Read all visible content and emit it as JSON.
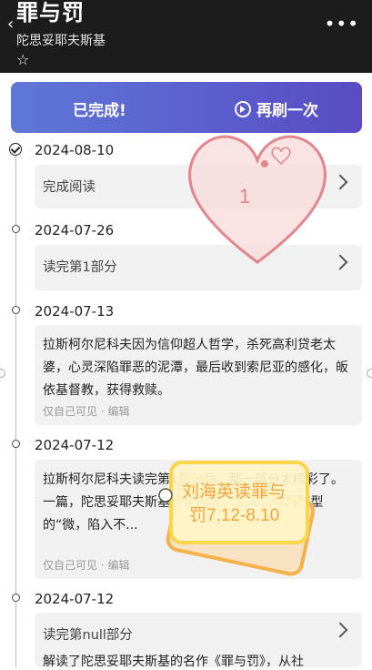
{
  "header": {
    "title": "罪与罚",
    "author": "陀思妥耶夫斯基",
    "star_glyph": "☆",
    "back_glyph": "‹",
    "more_glyph": "•••"
  },
  "banner": {
    "done_label": "已完成!",
    "refresh_label": "再刷一次"
  },
  "timeline": [
    {
      "date": "2024-08-10",
      "text": "完成阅读"
    },
    {
      "date": "2024-07-26",
      "text": "读完第1部分"
    },
    {
      "date": "2024-07-13",
      "text": "拉斯柯尔尼科夫因为信仰超人哲学，杀死高利贷老太婆，心灵深陷罪恶的泥潭，最后收到索尼亚的感化，皈依基督教，获得救赎。",
      "meta": "仅自己可见 · 编辑"
    },
    {
      "date": "2024-07-12",
      "text": "拉斯柯尔尼科夫读完第1部分后，那一部分太精彩了。一篇，陀思妥耶夫斯基诗学问题，主人公“复调”型的“微，陷入不...",
      "meta": "仅自己可见 · 编辑"
    },
    {
      "date": "2024-07-12",
      "text": "读完第null部分"
    }
  ],
  "last_snippet": "解读了陀思妥耶夫斯基的名作《罪与罚》，从社",
  "heart_sticker": {
    "number": "1",
    "color": "#e2868c"
  },
  "label_sticker": {
    "text_line1": "刘海英读罪与",
    "text_line2": "罚7.12-8.10",
    "color": "#f6b24a"
  }
}
